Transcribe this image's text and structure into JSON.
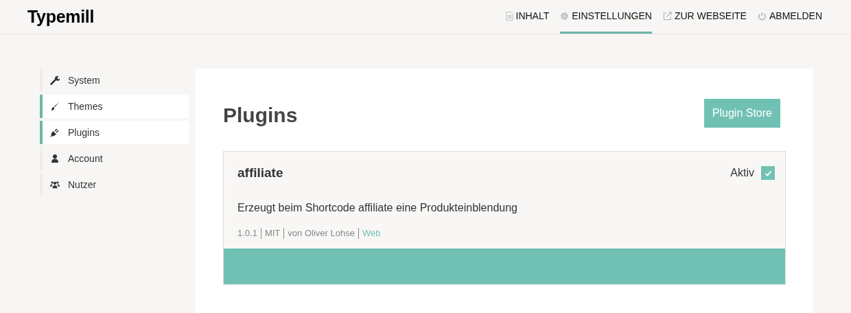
{
  "header": {
    "logo": "Typemill",
    "nav": [
      {
        "label": "INHALT",
        "selected": false
      },
      {
        "label": "EINSTELLUNGEN",
        "selected": true
      },
      {
        "label": "ZUR WEBSEITE",
        "selected": false
      },
      {
        "label": "ABMELDEN",
        "selected": false
      }
    ]
  },
  "sidebar": {
    "items": [
      {
        "label": "System",
        "selected": false
      },
      {
        "label": "Themes",
        "selected": true
      },
      {
        "label": "Plugins",
        "selected": true
      },
      {
        "label": "Account",
        "selected": false
      },
      {
        "label": "Nutzer",
        "selected": false
      }
    ]
  },
  "main": {
    "title": "Plugins",
    "button": "Plugin Store",
    "plugins": [
      {
        "name": "affiliate",
        "active_label": "Aktiv",
        "checked": true,
        "description": "Erzeugt beim Shortcode affiliate eine Produkteinblendung",
        "meta": [
          {
            "text": "1.0.1",
            "kind": "text"
          },
          {
            "text": "MIT",
            "kind": "text"
          },
          {
            "text": "von Oliver Lohse",
            "kind": "text"
          },
          {
            "text": "Web",
            "kind": "link"
          }
        ]
      }
    ]
  }
}
